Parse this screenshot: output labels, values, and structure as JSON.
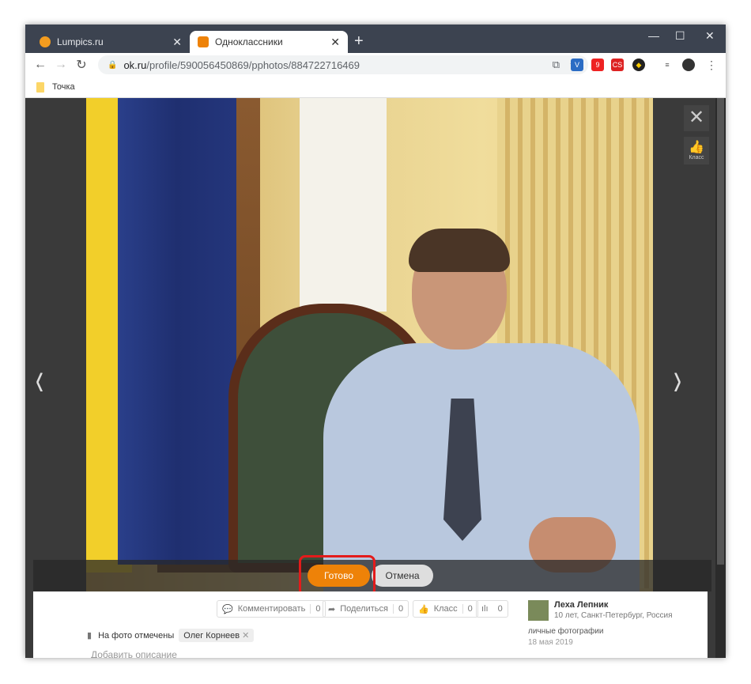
{
  "browser": {
    "tabs": [
      {
        "title": "Lumpics.ru",
        "active": false
      },
      {
        "title": "Одноклассники",
        "active": true
      }
    ],
    "url_domain": "ok.ru",
    "url_path": "/profile/590056450869/pphotos/884722716469",
    "bookmarks": [
      "Точка"
    ],
    "extension_badge": "9",
    "ext_cs": "CS"
  },
  "viewer": {
    "done_label": "Готово",
    "cancel_label": "Отмена",
    "klass_label": "Класс"
  },
  "actions": {
    "comment": {
      "label": "Комментировать",
      "count": "0"
    },
    "share": {
      "label": "Поделиться",
      "count": "0"
    },
    "like": {
      "label": "Класс",
      "count": "0"
    },
    "stats": {
      "count": "0"
    }
  },
  "tags": {
    "label": "На фото отмечены",
    "person": "Олег Корнеев"
  },
  "description_placeholder": "Добавить описание",
  "author": {
    "name": "Леха Лепник",
    "info": "10 лет, Санкт-Петербург, Россия",
    "album": "личные фотографии",
    "date": "18 мая 2019"
  },
  "colors": {
    "accent": "#ee8208",
    "highlight": "#e31b1b"
  }
}
